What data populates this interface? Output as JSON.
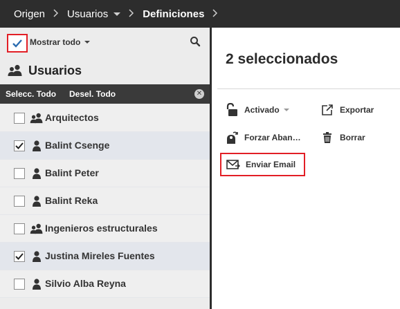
{
  "breadcrumb": {
    "items": [
      "Origen",
      "Usuarios",
      "Definiciones"
    ]
  },
  "left_panel": {
    "show_all_label": "Mostrar todo",
    "section_title": "Usuarios",
    "select_all_label": "Selecc. Todo",
    "deselect_all_label": "Desel. Todo",
    "items": [
      {
        "label": "Arquitectos",
        "type": "group",
        "checked": false
      },
      {
        "label": "Balint Csenge",
        "type": "user",
        "checked": true
      },
      {
        "label": "Balint Peter",
        "type": "user",
        "checked": false
      },
      {
        "label": "Balint Reka",
        "type": "user",
        "checked": false
      },
      {
        "label": "Ingenieros estructurales",
        "type": "group",
        "checked": false
      },
      {
        "label": "Justina Mireles Fuentes",
        "type": "user",
        "checked": true
      },
      {
        "label": "Silvio Alba Reyna",
        "type": "user",
        "checked": false
      }
    ]
  },
  "right_panel": {
    "selected_title": "2 seleccionados",
    "actions": {
      "activado": "Activado",
      "exportar": "Exportar",
      "forzar": "Forzar Aban…",
      "borrar": "Borrar",
      "email": "Enviar Email"
    }
  },
  "colors": {
    "topbar": "#2d2d2d",
    "highlight": "#e21e25",
    "checkmark_blue": "#2b6cb0",
    "row_alt": "#e3e6ec"
  },
  "icons": {
    "group": "users-icon",
    "user": "user-icon",
    "search": "search-icon",
    "lock": "lock-open-icon",
    "export": "export-icon",
    "force": "force-abandon-icon",
    "trash": "trash-icon",
    "email": "email-icon"
  }
}
